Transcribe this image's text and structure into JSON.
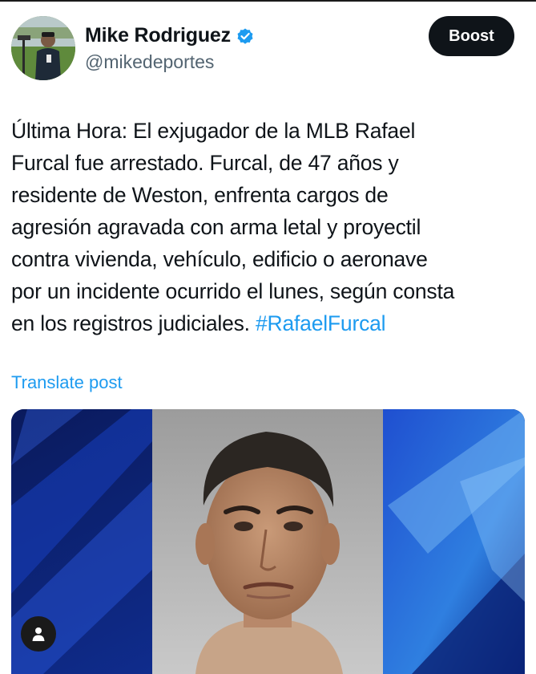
{
  "author": {
    "display_name": "Mike Rodriguez",
    "handle": "@mikedeportes",
    "verified_icon": "verified-badge-icon",
    "verified_color": "#1d9bf0"
  },
  "actions": {
    "boost_label": "Boost"
  },
  "post": {
    "text": "Última Hora: El exjugador de la MLB Rafael\nFurcal fue arrestado. Furcal, de 47 años y\nresidente de Weston, enfrenta cargos de\nagresión agravada con arma letal y proyectil\ncontra vivienda, vehículo, edificio o aeronave\npor un incidente ocurrido el lunes, según consta\nen los registros judiciales. ",
    "hashtag": "#RafaelFurcal",
    "translate_label": "Translate post"
  },
  "media": {
    "description_icon": "person-icon"
  },
  "colors": {
    "link": "#1d9bf0",
    "text": "#0f1419",
    "secondary": "#536471",
    "button_bg": "#0f1419"
  }
}
